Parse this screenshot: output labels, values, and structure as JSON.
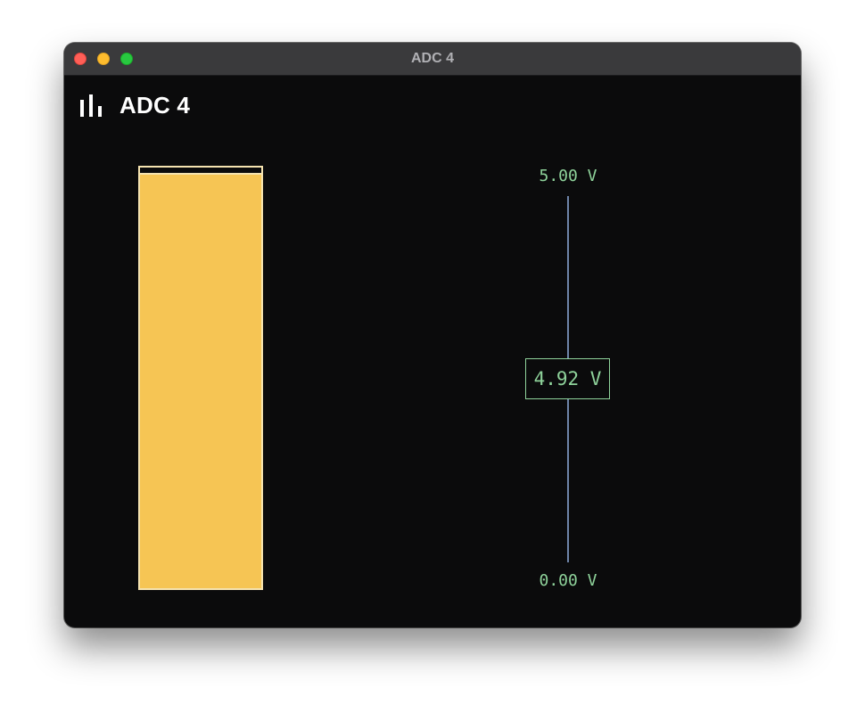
{
  "window": {
    "title": "ADC 4"
  },
  "header": {
    "icon": "bar-chart-icon",
    "title": "ADC 4"
  },
  "meter": {
    "value_label": "4.92 V",
    "value": 4.92,
    "min_label": "0.00 V",
    "max_label": "5.00 V",
    "min": 0,
    "max": 5,
    "fill_fraction": 0.984
  },
  "colors": {
    "fill": "#f6c554",
    "fill_border": "#f5e3b0",
    "scale_text": "#8fd39b",
    "scale_line": "#6d84a8",
    "background": "#0b0b0c"
  }
}
